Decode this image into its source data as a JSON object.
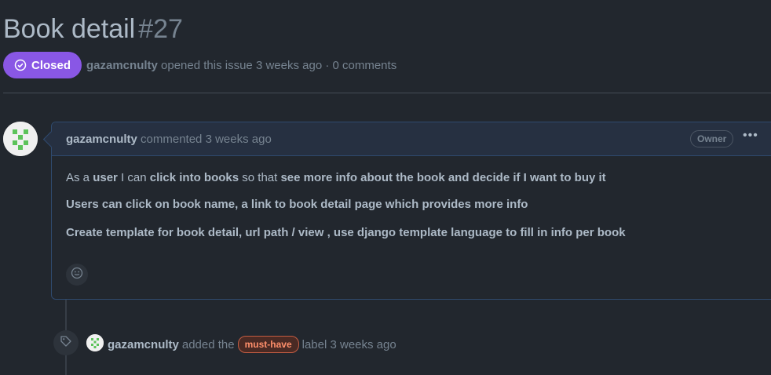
{
  "issue": {
    "title": "Book detail",
    "number": "#27",
    "state_label": "Closed",
    "author": "gazamcnulty",
    "meta_text": "opened this issue 3 weeks ago · 0 comments"
  },
  "comment": {
    "author": "gazamcnulty",
    "action": "commented 3 weeks ago",
    "role_badge": "Owner",
    "para1": {
      "a": "As a ",
      "b": "user",
      "c": " I can ",
      "d": "click into books",
      "e": " so that ",
      "f": "see more info about the book and decide if I want to buy it"
    },
    "para2": "Users can click on book name, a link to book detail page which provides more info",
    "para3": "Create template for book detail, url path / view , use django template language to fill in info per book"
  },
  "event": {
    "actor": "gazamcnulty",
    "text_before": "added the",
    "label": "must-have",
    "text_after": "label 3 weeks ago"
  },
  "colors": {
    "closed_badge": "#8957e5",
    "label_text": "#ff8f6b",
    "label_border": "#c35c42",
    "background": "#22272e"
  },
  "icons": {
    "state": "check-circle-icon",
    "more": "kebab-horizontal-icon",
    "reaction": "smiley-icon",
    "event": "tag-icon"
  }
}
